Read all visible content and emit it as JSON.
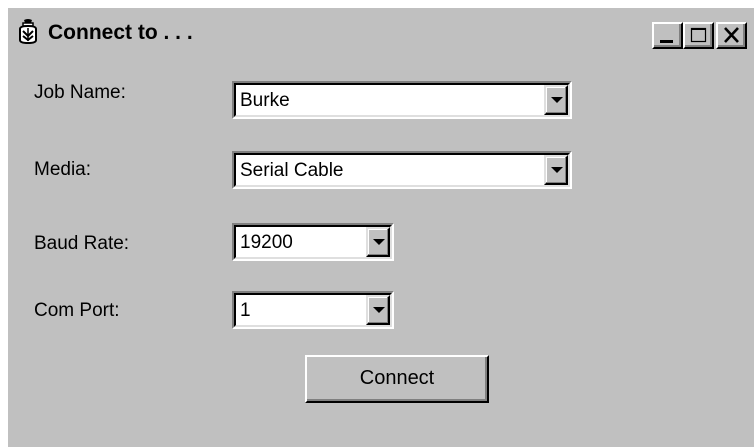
{
  "window": {
    "title": "Connect to . . .",
    "icon": "lantern-icon",
    "controls": {
      "minimize": "minimize-icon",
      "maximize": "maximize-icon",
      "close": "close-icon"
    }
  },
  "form": {
    "job_name": {
      "label": "Job Name:",
      "value": "Burke"
    },
    "media": {
      "label": "Media:",
      "value": "Serial Cable"
    },
    "baud_rate": {
      "label": "Baud Rate:",
      "value": "19200"
    },
    "com_port": {
      "label": "Com Port:",
      "value": "1"
    }
  },
  "actions": {
    "connect_label": "Connect"
  },
  "colors": {
    "face": "#c0c0c0",
    "highlight": "#ffffff",
    "shadow": "#808080",
    "dark_shadow": "#000000",
    "field": "#ffffff"
  }
}
